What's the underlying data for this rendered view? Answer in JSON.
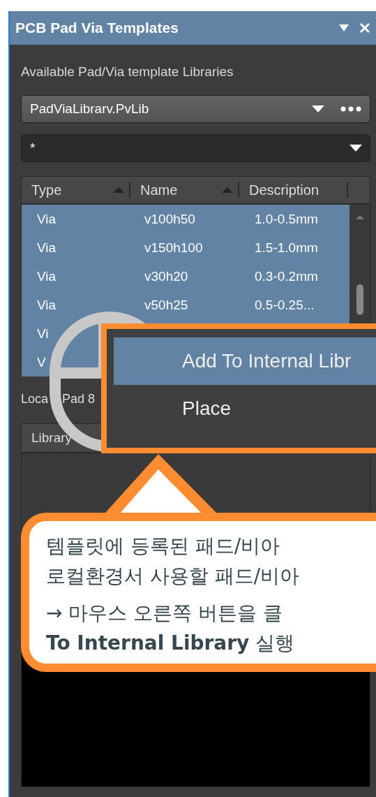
{
  "window": {
    "title": "PCB Pad Via Templates"
  },
  "libraries_label": "Available Pad/Via template Libraries",
  "library_dropdown": {
    "value": "PadViaLibrarv.PvLib"
  },
  "filter": {
    "value": "*"
  },
  "template_table": {
    "columns": [
      {
        "label": "Type",
        "sorted": true
      },
      {
        "label": "Name",
        "sorted": true
      },
      {
        "label": "Description",
        "sorted": false
      }
    ],
    "rows": [
      {
        "type": "Via",
        "name": "v100h50",
        "description": "1.0-0.5mm",
        "selected": true
      },
      {
        "type": "Via",
        "name": "v150h100",
        "description": "1.5-1.0mm",
        "selected": true
      },
      {
        "type": "Via",
        "name": "v30h20",
        "description": "0.3-0.2mm",
        "selected": true
      },
      {
        "type": "Via",
        "name": "v50h25",
        "description": "0.5-0.25...",
        "selected": true
      },
      {
        "type": "Vi",
        "selected": true
      },
      {
        "type": "V",
        "selected": true
      }
    ]
  },
  "local_label": [
    "Loca",
    "Pad 8"
  ],
  "local_table": {
    "columns": [
      "Library"
    ]
  },
  "context_menu": {
    "items": [
      {
        "label": "Add To Internal Libr",
        "selected": true
      },
      {
        "label": "Place",
        "selected": false
      }
    ]
  },
  "callout": {
    "paragraphs": [
      [
        "템플릿에 등록된 패드/비아",
        "로컬환경서 사용할 패드/비아"
      ],
      [
        "→ 마우스 오른쪽 버튼을 클",
        "**To Internal Library** 실행"
      ]
    ]
  }
}
